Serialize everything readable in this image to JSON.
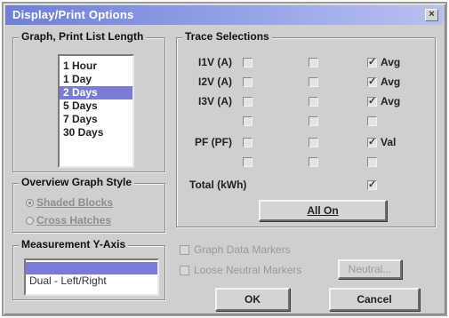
{
  "window": {
    "title": "Display/Print Options",
    "close_glyph": "×"
  },
  "graph_length": {
    "legend": "Graph, Print List Length",
    "items": [
      "1 Hour",
      "1 Day",
      "2 Days",
      "5 Days",
      "7 Days",
      "30 Days"
    ],
    "selected": "2 Days"
  },
  "overview_style": {
    "legend": "Overview Graph Style",
    "options": [
      "Shaded Blocks",
      "Cross Hatches"
    ],
    "selected": "Shaded Blocks"
  },
  "measurement_axis": {
    "legend": "Measurement Y-Axis",
    "items": [
      "",
      "Dual - Left/Right"
    ],
    "selected_index": 0
  },
  "trace": {
    "legend": "Trace Selections",
    "rows": [
      {
        "label": "I1V (A)",
        "c1": false,
        "c2": false,
        "c3": true,
        "c3_label": "Avg"
      },
      {
        "label": "I2V (A)",
        "c1": false,
        "c2": false,
        "c3": true,
        "c3_label": "Avg"
      },
      {
        "label": "I3V (A)",
        "c1": false,
        "c2": false,
        "c3": true,
        "c3_label": "Avg"
      },
      {
        "label": "",
        "c1": false,
        "c2": false,
        "c3": false,
        "c3_label": ""
      },
      {
        "label": "PF (PF)",
        "c1": false,
        "c2": false,
        "c3": true,
        "c3_label": "Val"
      },
      {
        "label": "",
        "c1": false,
        "c2": false,
        "c3": false,
        "c3_label": ""
      }
    ],
    "total_label": "Total (kWh)",
    "total_checked": true,
    "all_on_label": "All On"
  },
  "options": {
    "graph_data_markers": "Graph Data Markers",
    "loose_neutral_markers": "Loose Neutral Markers",
    "neutral_button": "Neutral..."
  },
  "buttons": {
    "ok": "OK",
    "cancel": "Cancel"
  },
  "colors": {
    "title_start": "#6f7fd8",
    "selection": "#7a7ad8",
    "face": "#cfcfcf"
  }
}
